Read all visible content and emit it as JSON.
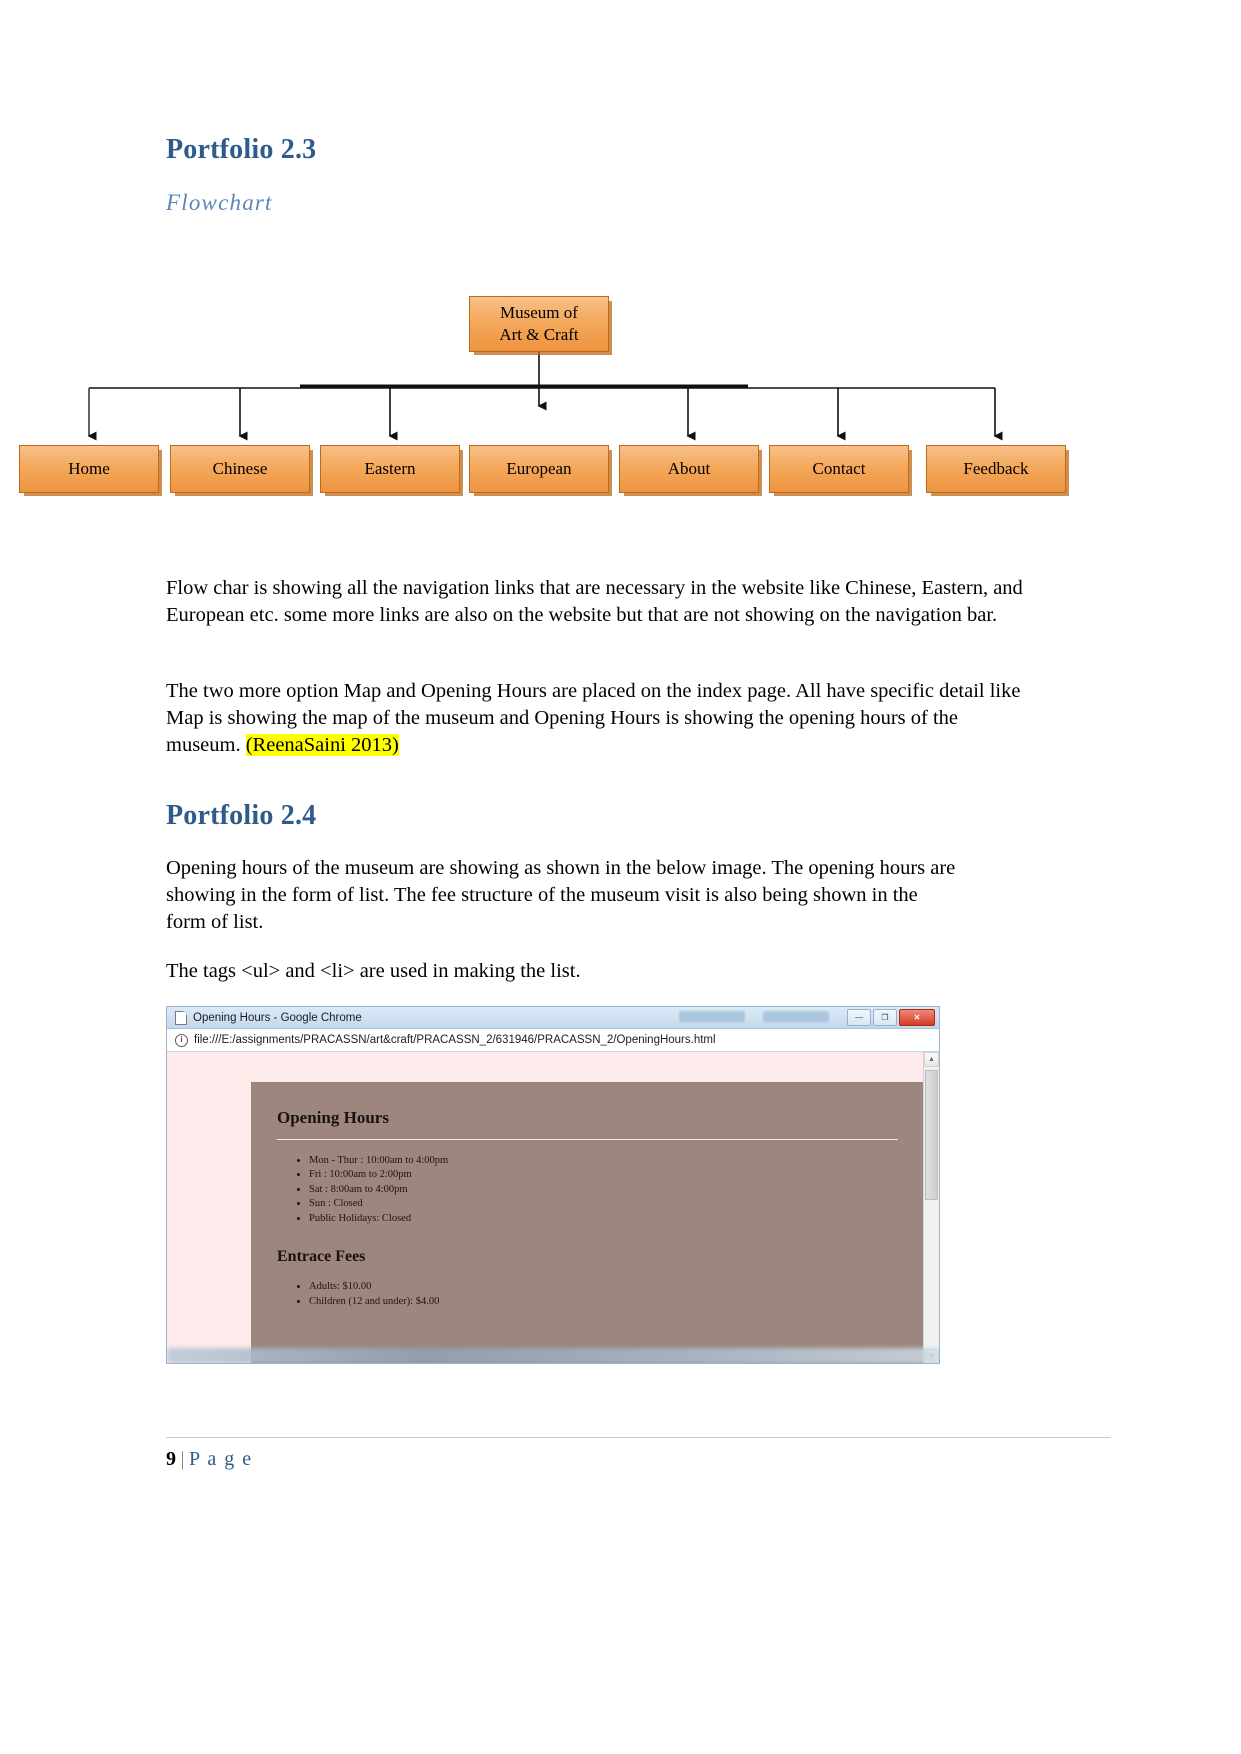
{
  "document": {
    "heading_23": "Portfolio 2.3",
    "subheading": "Flowchart",
    "heading_24": "Portfolio 2.4",
    "paragraph_1": "Flow char is showing all the navigation links that are necessary in the website like Chinese, Eastern, and European etc. some more links are also on the website but that are not showing on the navigation bar.",
    "paragraph_2_pre": "The two more option Map and Opening Hours are placed on the index page. All have specific detail like Map is showing the map of the museum and Opening Hours is showing the opening hours of the museum. ",
    "paragraph_2_citation": "(ReenaSaini 2013)",
    "paragraph_3": "Opening hours of the museum are showing as shown in the below image. The opening hours are showing in the form of list. The fee structure of the museum visit is also being shown in the form of list.",
    "paragraph_4": "The tags <ul> and <li> are used in making the list."
  },
  "flowchart": {
    "root": {
      "line1": "Museum of",
      "line2": "Art & Craft"
    },
    "leaves": [
      {
        "label": "Home"
      },
      {
        "label": "Chinese"
      },
      {
        "label": "Eastern"
      },
      {
        "label": "European"
      },
      {
        "label": "About"
      },
      {
        "label": "Contact"
      },
      {
        "label": "Feedback"
      }
    ],
    "colors": {
      "fill_top": "#F7C08A",
      "fill_bottom": "#EE9440",
      "border": "#C06A16",
      "shadow": "#BE6919"
    }
  },
  "browser": {
    "title": "Opening Hours - Google Chrome",
    "url": "file:///E:/assignments/PRACASSN/art&craft/PRACASSN_2/631946/PRACASSN_2/OpeningHours.html",
    "window_buttons": {
      "minimize": "—",
      "maximize": "❐",
      "close": "✕"
    },
    "page": {
      "heading_hours": "Opening Hours",
      "hours": [
        "Mon - Thur : 10:00am to 4:00pm",
        "Fri : 10:00am to 2:00pm",
        "Sat : 8:00am to 4:00pm",
        "Sun : Closed",
        "Public Holidays: Closed"
      ],
      "heading_fees": "Entrace Fees",
      "fees": [
        "Adults: $10.00",
        "Children (12 and under): $4.00"
      ],
      "colors": {
        "page_background": "#fdeaea",
        "content_background": "#9c867d"
      }
    }
  },
  "footer": {
    "page_number": "9",
    "separator": "|",
    "page_word": "P a g e"
  }
}
